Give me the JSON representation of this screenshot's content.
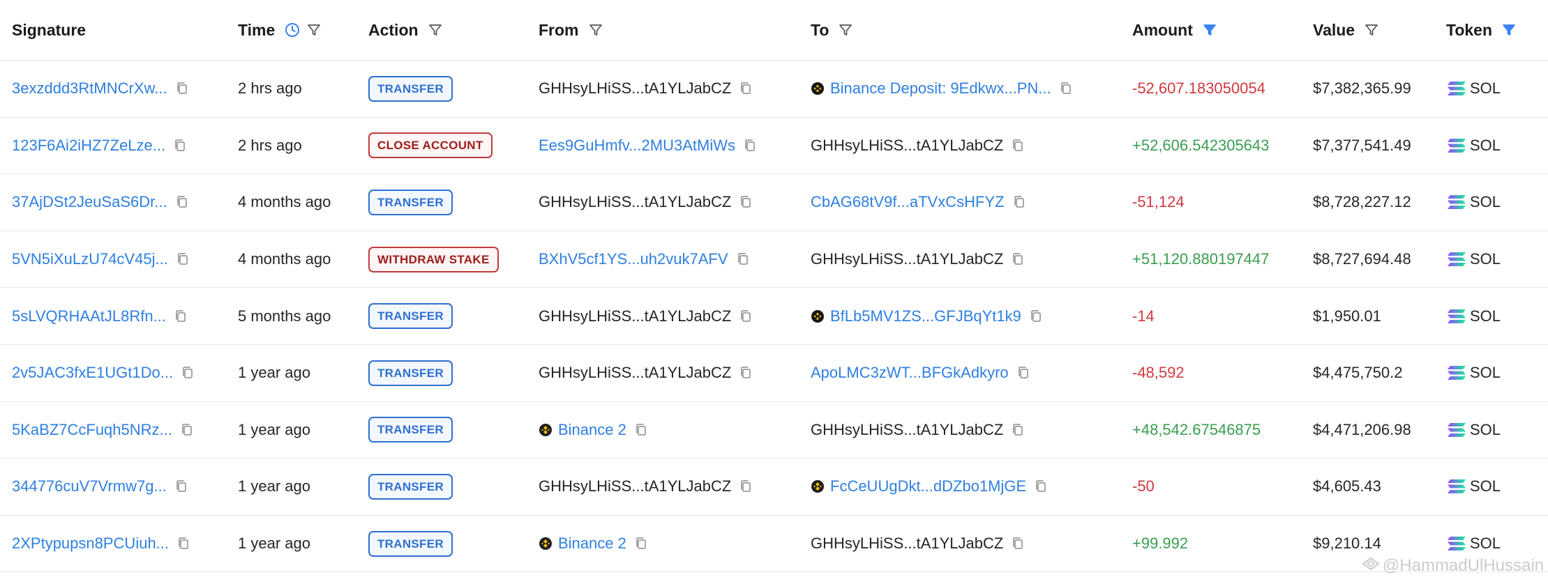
{
  "headers": {
    "signature": "Signature",
    "time": "Time",
    "action": "Action",
    "from": "From",
    "to": "To",
    "amount": "Amount",
    "value": "Value",
    "token": "Token"
  },
  "colors": {
    "link": "#2f7fe0",
    "negative": "#d0393e",
    "positive": "#3a9d4f",
    "transfer_badge": "#2e6fd0",
    "danger_badge": "#c03a3a",
    "active_filter": "#3b82f6"
  },
  "rows": [
    {
      "signature": "3exzddd3RtMNCrXw...",
      "time": "2 hrs ago",
      "action": "TRANSFER",
      "action_style": "blue",
      "from": "GHHsyLHiSS...tA1YLJabCZ",
      "from_link": false,
      "from_logo": false,
      "to": "Binance Deposit: 9Edkwx...PN...",
      "to_link": true,
      "to_logo": "circle-dark",
      "amount": "-52,607.183050054",
      "amount_sign": "neg",
      "value": "$7,382,365.99",
      "token": "SOL"
    },
    {
      "signature": "123F6Ai2iHZ7ZeLze...",
      "time": "2 hrs ago",
      "action": "CLOSE ACCOUNT",
      "action_style": "red",
      "from": "Ees9GuHmfv...2MU3AtMiWs",
      "from_link": true,
      "from_logo": false,
      "to": "GHHsyLHiSS...tA1YLJabCZ",
      "to_link": false,
      "to_logo": false,
      "amount": "+52,606.542305643",
      "amount_sign": "pos",
      "value": "$7,377,541.49",
      "token": "SOL"
    },
    {
      "signature": "37AjDSt2JeuSaS6Dr...",
      "time": "4 months ago",
      "action": "TRANSFER",
      "action_style": "blue",
      "from": "GHHsyLHiSS...tA1YLJabCZ",
      "from_link": false,
      "from_logo": false,
      "to": "CbAG68tV9f...aTVxCsHFYZ",
      "to_link": true,
      "to_logo": false,
      "amount": "-51,124",
      "amount_sign": "neg",
      "value": "$8,728,227.12",
      "token": "SOL"
    },
    {
      "signature": "5VN5iXuLzU74cV45j...",
      "time": "4 months ago",
      "action": "WITHDRAW STAKE",
      "action_style": "red",
      "from": "BXhV5cf1YS...uh2vuk7AFV",
      "from_link": true,
      "from_logo": false,
      "to": "GHHsyLHiSS...tA1YLJabCZ",
      "to_link": false,
      "to_logo": false,
      "amount": "+51,120.880197447",
      "amount_sign": "pos",
      "value": "$8,727,694.48",
      "token": "SOL"
    },
    {
      "signature": "5sLVQRHAAtJL8Rfn...",
      "time": "5 months ago",
      "action": "TRANSFER",
      "action_style": "blue",
      "from": "GHHsyLHiSS...tA1YLJabCZ",
      "from_link": false,
      "from_logo": false,
      "to": "BfLb5MV1ZS...GFJBqYt1k9",
      "to_link": true,
      "to_logo": "circle-dark",
      "amount": "-14",
      "amount_sign": "neg",
      "value": "$1,950.01",
      "token": "SOL"
    },
    {
      "signature": "2v5JAC3fxE1UGt1Do...",
      "time": "1 year ago",
      "action": "TRANSFER",
      "action_style": "blue",
      "from": "GHHsyLHiSS...tA1YLJabCZ",
      "from_link": false,
      "from_logo": false,
      "to": "ApoLMC3zWT...BFGkAdkyro",
      "to_link": true,
      "to_logo": false,
      "amount": "-48,592",
      "amount_sign": "neg",
      "value": "$4,475,750.2",
      "token": "SOL"
    },
    {
      "signature": "5KaBZ7CcFuqh5NRz...",
      "time": "1 year ago",
      "action": "TRANSFER",
      "action_style": "blue",
      "from": "Binance 2",
      "from_link": true,
      "from_logo": "binance",
      "to": "GHHsyLHiSS...tA1YLJabCZ",
      "to_link": false,
      "to_logo": false,
      "amount": "+48,542.67546875",
      "amount_sign": "pos",
      "value": "$4,471,206.98",
      "token": "SOL"
    },
    {
      "signature": "344776cuV7Vrmw7g...",
      "time": "1 year ago",
      "action": "TRANSFER",
      "action_style": "blue",
      "from": "GHHsyLHiSS...tA1YLJabCZ",
      "from_link": false,
      "from_logo": false,
      "to": "FcCeUUgDkt...dDZbo1MjGE",
      "to_link": true,
      "to_logo": "binance",
      "amount": "-50",
      "amount_sign": "neg",
      "value": "$4,605.43",
      "token": "SOL"
    },
    {
      "signature": "2XPtypupsn8PCUiuh...",
      "time": "1 year ago",
      "action": "TRANSFER",
      "action_style": "blue",
      "from": "Binance 2",
      "from_link": true,
      "from_logo": "binance",
      "to": "GHHsyLHiSS...tA1YLJabCZ",
      "to_link": false,
      "to_logo": false,
      "amount": "+99.992",
      "amount_sign": "pos",
      "value": "$9,210.14",
      "token": "SOL"
    }
  ],
  "watermark": "@HammadUlHussain"
}
